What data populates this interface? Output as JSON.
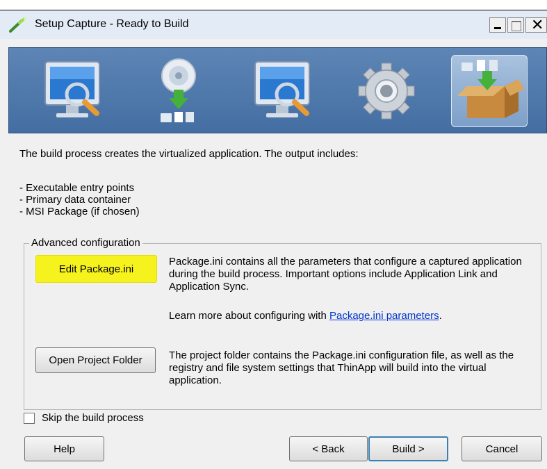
{
  "window": {
    "title": "Setup Capture - Ready to Build",
    "app_icon": "thinapp-wand-icon",
    "controls": [
      "minimize",
      "maximize",
      "close"
    ]
  },
  "steps": [
    {
      "icon": "monitor-magnifier-icon",
      "active": false
    },
    {
      "icon": "disc-download-icon",
      "active": false
    },
    {
      "icon": "monitor-magnifier-icon",
      "active": false
    },
    {
      "icon": "gear-icon",
      "active": false
    },
    {
      "icon": "package-box-icon",
      "active": true
    }
  ],
  "intro": "The build process creates the virtualized application. The output includes:",
  "bullets": [
    "- Executable entry points",
    "- Primary data container",
    "- MSI Package (if chosen)"
  ],
  "advanced": {
    "title": "Advanced configuration",
    "edit_button": "Edit Package.ini",
    "edit_desc": "Package.ini contains all the parameters that configure a captured application during the build process. Important options include Application Link and Application Sync.",
    "learn_prefix": "Learn more about configuring with ",
    "learn_link": "Package.ini parameters",
    "learn_suffix": ".",
    "open_button": "Open Project Folder",
    "open_desc": "The project folder contains the Package.ini configuration file, as well as the registry and file system settings that ThinApp will build into the virtual application."
  },
  "skip_label": "Skip the build process",
  "skip_checked": false,
  "buttons": {
    "help": "Help",
    "back": "< Back",
    "build": "Build >",
    "cancel": "Cancel"
  },
  "colors": {
    "banner": "#4f78ab",
    "highlight": "#f6f21e",
    "link": "#0033cc"
  }
}
